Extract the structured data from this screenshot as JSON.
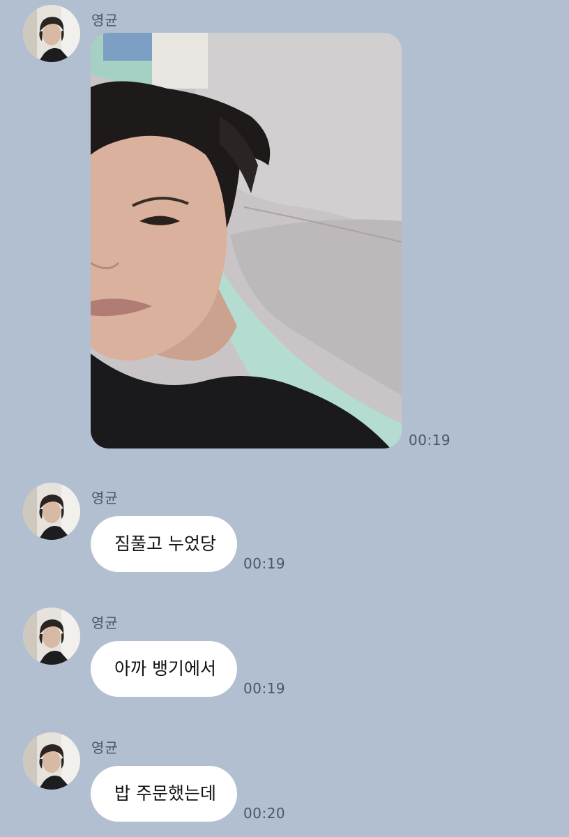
{
  "background_color": "#b1bfd0",
  "bubble_color": "#ffffff",
  "messages": [
    {
      "sender": "영균",
      "type": "photo",
      "avatar": "sender-avatar",
      "time": "00:19"
    },
    {
      "sender": "영균",
      "type": "text",
      "text": "짐풀고 누었당",
      "time": "00:19"
    },
    {
      "sender": "영균",
      "type": "text",
      "text": "아까 뱅기에서",
      "time": "00:19"
    },
    {
      "sender": "영균",
      "type": "text",
      "text": "밥 주문했는데",
      "time": "00:20"
    }
  ]
}
